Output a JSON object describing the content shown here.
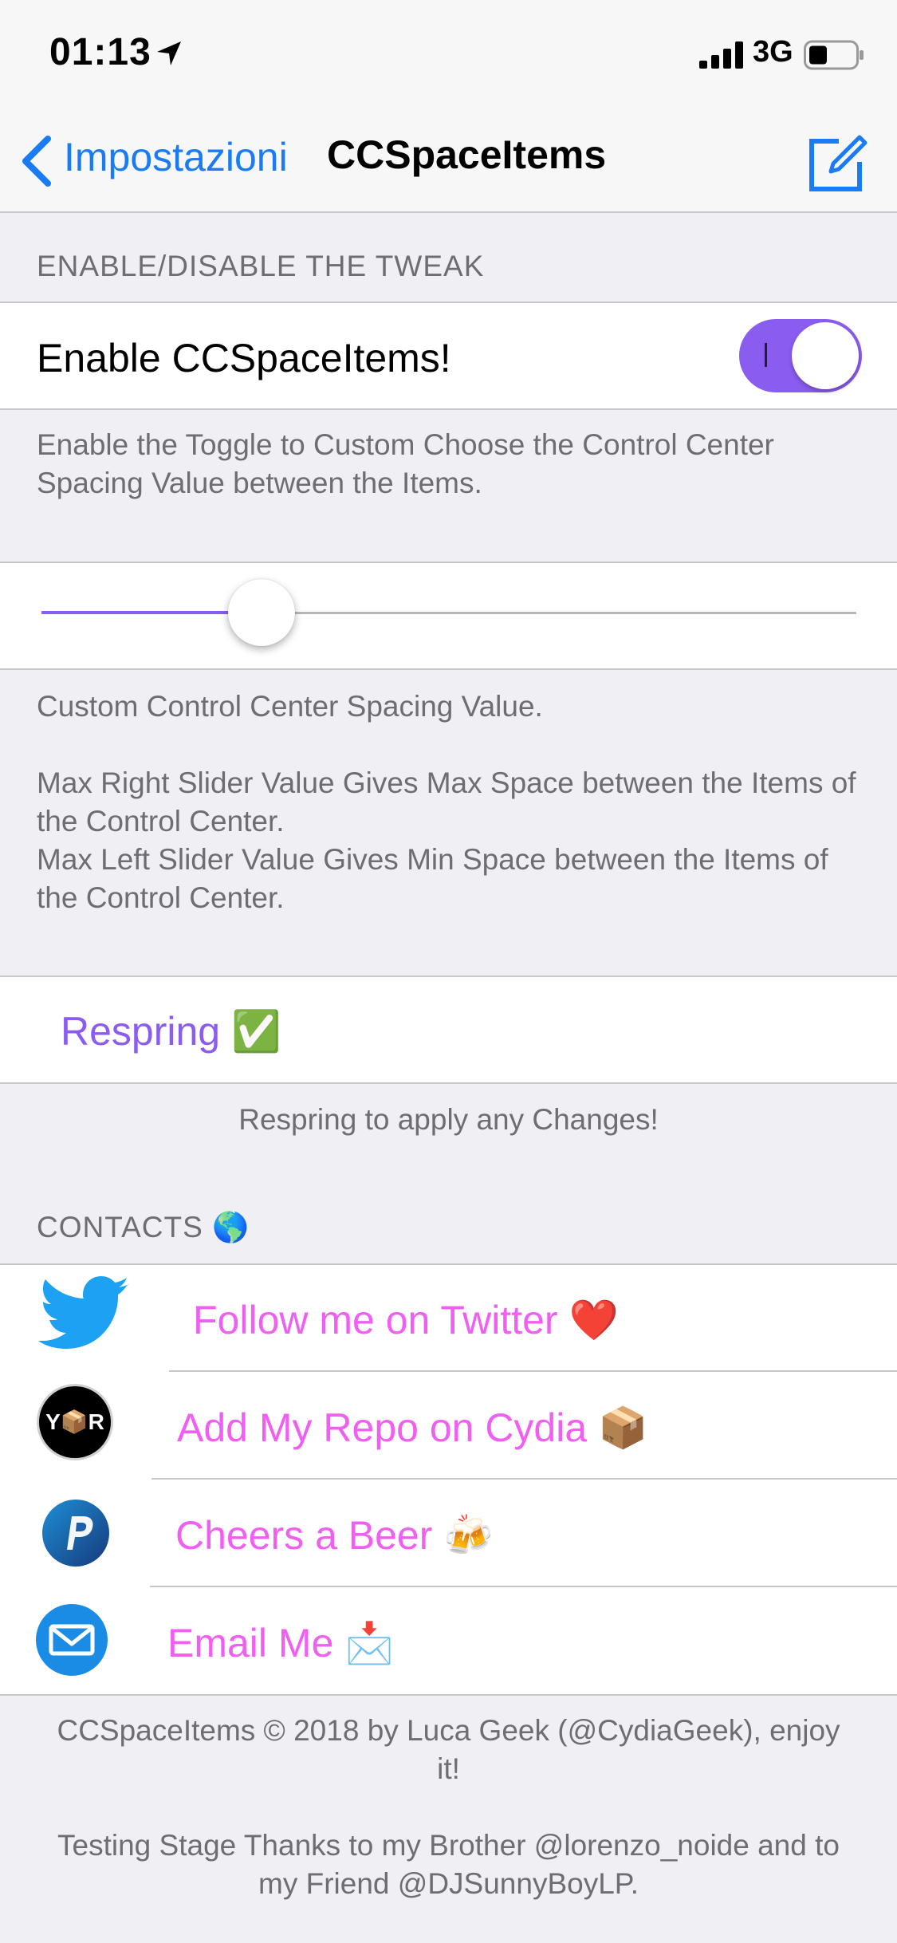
{
  "status": {
    "time": "01:13",
    "network": "3G"
  },
  "nav": {
    "back_label": "Impostazioni",
    "title": "CCSpaceItems"
  },
  "tweak_section": {
    "header": "ENABLE/DISABLE THE TWEAK",
    "toggle_label": "Enable CCSpaceItems!",
    "toggle_on": true,
    "footer": "Enable the Toggle to Custom Choose the Control Center Spacing Value between the Items."
  },
  "spacing": {
    "slider_fraction": 0.27,
    "footer_line1": "Custom Control Center Spacing Value.",
    "footer_line2": "Max Right Slider Value Gives Max Space between the Items of the Control Center.",
    "footer_line3": "Max Left Slider Value Gives Min Space between the Items of the Control Center."
  },
  "respring": {
    "label": "Respring ✅",
    "footer": "Respring to apply any Changes!"
  },
  "contacts": {
    "header": "CONTACTS 🌎",
    "items": [
      {
        "label": "Follow me on Twitter ❤️",
        "icon": "twitter-icon"
      },
      {
        "label": "Add My Repo on Cydia 📦",
        "icon": "repo-icon",
        "icon_text": "Y📦R"
      },
      {
        "label": "Cheers a Beer 🍻",
        "icon": "paypal-icon"
      },
      {
        "label": "Email Me 📩",
        "icon": "mail-icon"
      }
    ]
  },
  "footer": {
    "line1": "CCSpaceItems © 2018 by Luca Geek (@CydiaGeek), enjoy it!",
    "line2": "Testing Stage Thanks to my Brother @lorenzo_noide and to my Friend @DJSunnyBoyLP."
  },
  "colors": {
    "accent": "#8b5cf0",
    "link_pink": "#f05ef2",
    "ios_blue": "#1a7cf5"
  }
}
